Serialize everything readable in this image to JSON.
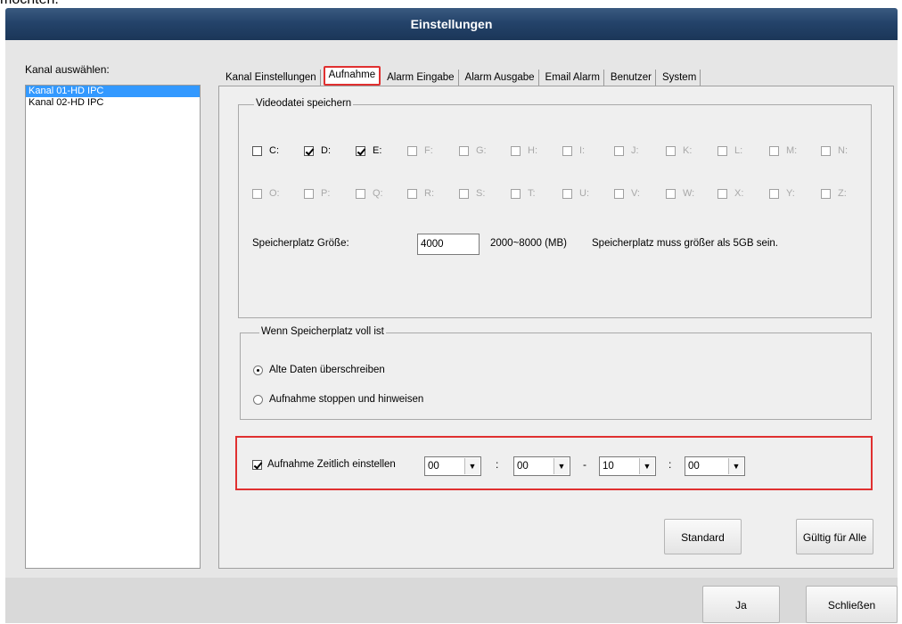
{
  "top_text": "möchten.",
  "window": {
    "title": "Einstellungen"
  },
  "channels": {
    "label": "Kanal auswählen:",
    "items": [
      "Kanal 01-HD IPC",
      "Kanal 02-HD IPC"
    ],
    "selected": 0
  },
  "tabs": [
    "Kanal Einstellungen",
    "Aufnahme",
    "Alarm Eingabe",
    "Alarm Ausgabe",
    "Email Alarm",
    "Benutzer",
    "System"
  ],
  "active_tab": 1,
  "video_save": {
    "title": "Videodatei speichern",
    "drives_row1": [
      {
        "label": "C:",
        "checked": false,
        "enabled": true
      },
      {
        "label": "D:",
        "checked": true,
        "enabled": true
      },
      {
        "label": "E:",
        "checked": true,
        "enabled": true
      },
      {
        "label": "F:",
        "checked": false,
        "enabled": false
      },
      {
        "label": "G:",
        "checked": false,
        "enabled": false
      },
      {
        "label": "H:",
        "checked": false,
        "enabled": false
      },
      {
        "label": "I:",
        "checked": false,
        "enabled": false
      },
      {
        "label": "J:",
        "checked": false,
        "enabled": false
      },
      {
        "label": "K:",
        "checked": false,
        "enabled": false
      },
      {
        "label": "L:",
        "checked": false,
        "enabled": false
      },
      {
        "label": "M:",
        "checked": false,
        "enabled": false
      },
      {
        "label": "N:",
        "checked": false,
        "enabled": false
      }
    ],
    "drives_row2": [
      {
        "label": "O:",
        "checked": false,
        "enabled": false
      },
      {
        "label": "P:",
        "checked": false,
        "enabled": false
      },
      {
        "label": "Q:",
        "checked": false,
        "enabled": false
      },
      {
        "label": "R:",
        "checked": false,
        "enabled": false
      },
      {
        "label": "S:",
        "checked": false,
        "enabled": false
      },
      {
        "label": "T:",
        "checked": false,
        "enabled": false
      },
      {
        "label": "U:",
        "checked": false,
        "enabled": false
      },
      {
        "label": "V:",
        "checked": false,
        "enabled": false
      },
      {
        "label": "W:",
        "checked": false,
        "enabled": false
      },
      {
        "label": "X:",
        "checked": false,
        "enabled": false
      },
      {
        "label": "Y:",
        "checked": false,
        "enabled": false
      },
      {
        "label": "Z:",
        "checked": false,
        "enabled": false
      }
    ],
    "size_label": "Speicherplatz Größe:",
    "size_value": "4000",
    "size_range": "2000~8000 (MB)",
    "size_hint": "Speicherplatz muss größer als 5GB sein."
  },
  "full_storage": {
    "title": "Wenn Speicherplatz voll ist",
    "options": [
      "Alte Daten überschreiben",
      "Aufnahme stoppen und hinweisen"
    ],
    "selected": 0
  },
  "schedule": {
    "enabled": true,
    "label": "Aufnahme Zeitlich einstellen",
    "start_hour": "00",
    "start_min": "00",
    "end_hour": "10",
    "end_min": "00",
    "sep_colon": ":",
    "sep_dash": "-"
  },
  "buttons": {
    "standard": "Standard",
    "apply_all": "Gültig für Alle",
    "ok": "Ja",
    "close": "Schließen"
  },
  "colors": {
    "highlight": "#e03030",
    "selection": "#3399ff",
    "title_bar": "#24436a"
  }
}
